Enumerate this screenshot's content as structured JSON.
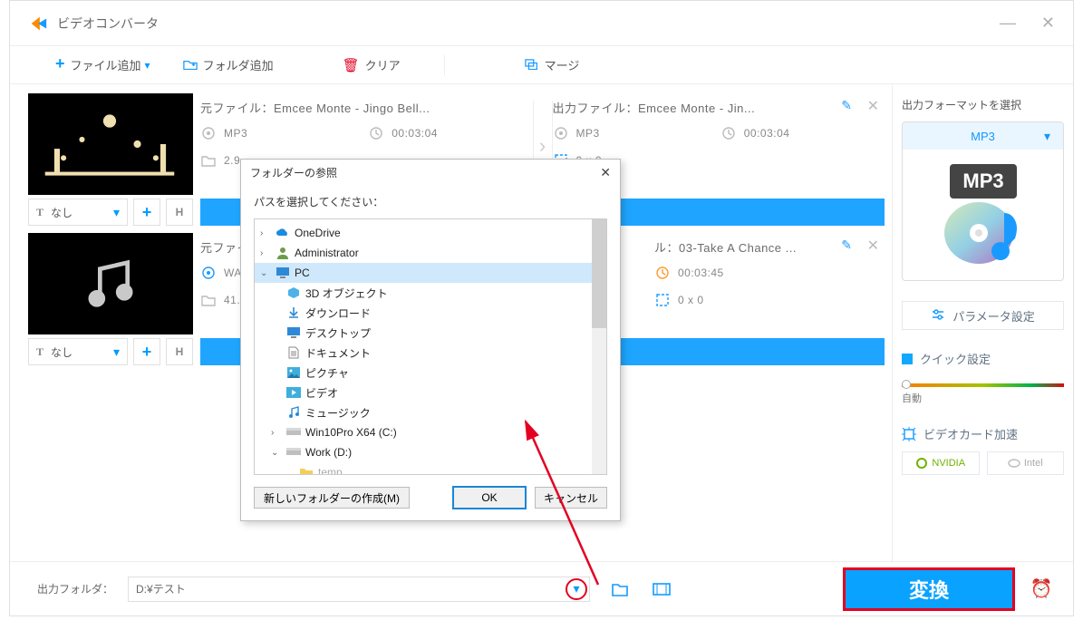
{
  "app": {
    "title": "ビデオコンバータ"
  },
  "toolbar": {
    "add_file": "ファイル追加",
    "add_folder": "フォルダ追加",
    "clear": "クリア",
    "merge": "マージ"
  },
  "cards": [
    {
      "subtitle": {
        "value": "なし"
      },
      "src": {
        "label": "元ファイル：",
        "name": "Emcee Monte - Jingo Bell...",
        "format": "MP3",
        "duration": "00:03:04",
        "size": "2.9"
      },
      "out": {
        "label": "出力ファイル：",
        "name": "Emcee Monte - Jin...",
        "format": "MP3",
        "duration": "00:03:04",
        "dim": "0 x 0"
      }
    },
    {
      "subtitle": {
        "value": "なし"
      },
      "src": {
        "label": "元ファイ",
        "name": "",
        "format": "WAV",
        "duration": "",
        "size": "41."
      },
      "out": {
        "label": "ル：",
        "name": "03-Take A Chance ...",
        "format": "",
        "duration": "00:03:45",
        "dim": "0 x 0"
      }
    }
  ],
  "dialog": {
    "title": "フォルダーの参照",
    "instruction": "パスを選択してください：",
    "tree": [
      {
        "label": "OneDrive",
        "icon": "cloud",
        "depth": 0,
        "caret": ">"
      },
      {
        "label": "Administrator",
        "icon": "user",
        "depth": 0,
        "caret": ">"
      },
      {
        "label": "PC",
        "icon": "pc",
        "depth": 0,
        "caret": "v",
        "sel": true
      },
      {
        "label": "3D オブジェクト",
        "icon": "cube",
        "depth": 1
      },
      {
        "label": "ダウンロード",
        "icon": "download",
        "depth": 1
      },
      {
        "label": "デスクトップ",
        "icon": "desktop",
        "depth": 1
      },
      {
        "label": "ドキュメント",
        "icon": "doc",
        "depth": 1
      },
      {
        "label": "ピクチャ",
        "icon": "pic",
        "depth": 1
      },
      {
        "label": "ビデオ",
        "icon": "video",
        "depth": 1
      },
      {
        "label": "ミュージック",
        "icon": "music",
        "depth": 1
      },
      {
        "label": "Win10Pro X64 (C:)",
        "icon": "drive",
        "depth": 1,
        "caret": ">"
      },
      {
        "label": "Work (D:)",
        "icon": "drive",
        "depth": 1,
        "caret": "v"
      },
      {
        "label": "temp",
        "icon": "folder",
        "depth": 2
      }
    ],
    "new_folder": "新しいフォルダーの作成(M)",
    "ok": "OK",
    "cancel": "キャンセル"
  },
  "sidebar": {
    "heading": "出力フォーマットを選択",
    "format": "MP3",
    "param": "パラメータ設定",
    "quick": "クイック設定",
    "slider_label": "自動",
    "gpu": "ビデオカード加速",
    "brands": {
      "nvidia": "NVIDIA",
      "intel": "Intel"
    }
  },
  "bottom": {
    "label": "出力フォルダ：",
    "path": "D:¥テスト",
    "convert": "変換"
  }
}
